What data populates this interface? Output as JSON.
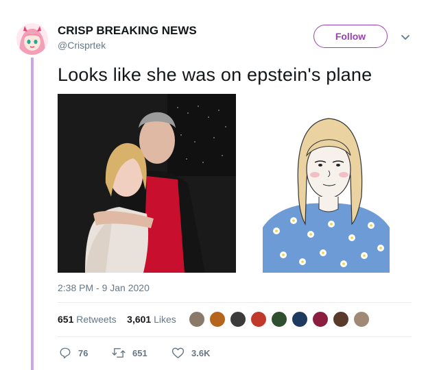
{
  "account": {
    "name": "CRISP BREAKING NEWS",
    "handle": "@Crisprtek"
  },
  "buttons": {
    "follow_label": "Follow"
  },
  "tweet": {
    "text": "Looks like she was on epstein's plane",
    "timestamp": "2:38 PM - 9 Jan 2020"
  },
  "stats": {
    "retweets_count": "651",
    "retweets_label": "Retweets",
    "likes_count": "3,601",
    "likes_label": "Likes"
  },
  "liker_avatars": [
    {
      "color": "#8a7a6a"
    },
    {
      "color": "#b5651d"
    },
    {
      "color": "#3b3b3b"
    },
    {
      "color": "#c0392b"
    },
    {
      "color": "#2f4f2f"
    },
    {
      "color": "#1f3a5f"
    },
    {
      "color": "#8b1e3f"
    },
    {
      "color": "#5a3a2a"
    },
    {
      "color": "#a08a76"
    }
  ],
  "actions": {
    "replies": "76",
    "retweets": "651",
    "likes": "3.6K"
  },
  "icons": {
    "avatar": "anime-girl-avatar",
    "caret": "chevron-down-icon",
    "reply": "reply-icon",
    "retweet": "retweet-icon",
    "like": "heart-icon"
  },
  "colors": {
    "accent": "#9b3fb5",
    "thread_line": "#c9a6e6",
    "secondary_text": "#657786",
    "primary_text": "#14171a"
  }
}
